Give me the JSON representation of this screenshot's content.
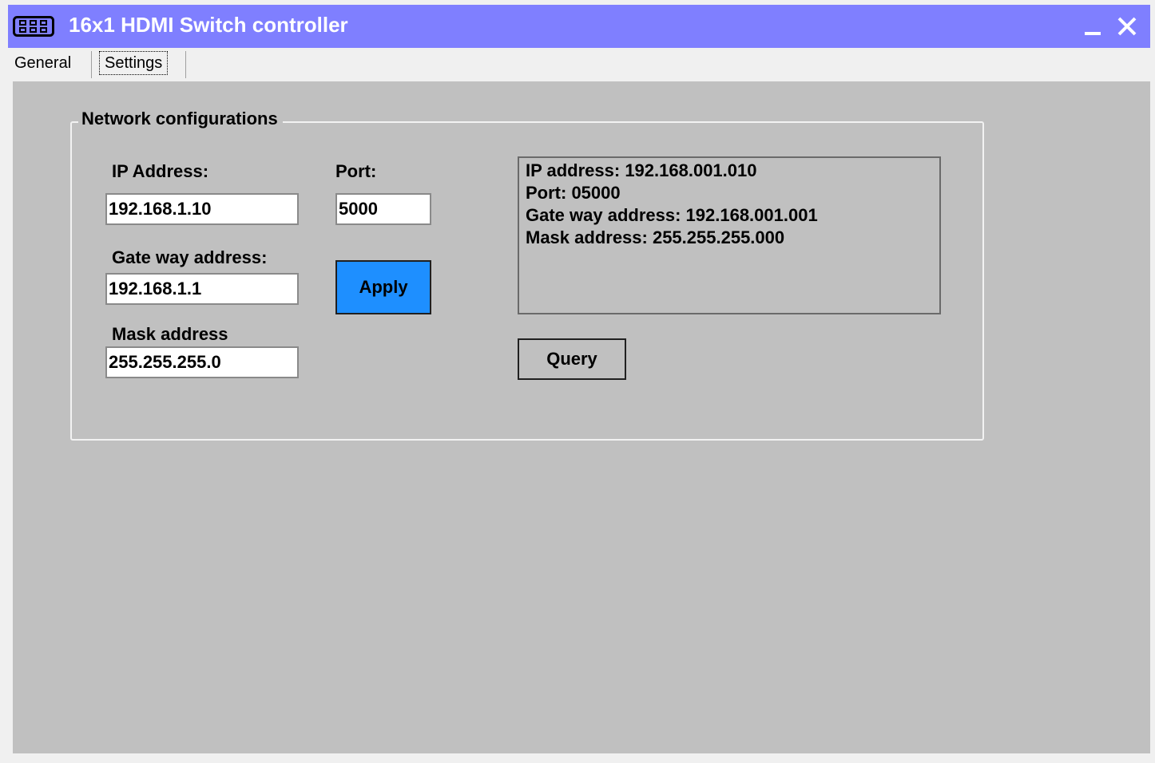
{
  "window": {
    "title": "16x1 HDMI Switch controller",
    "accent_color": "#7f7fff",
    "minimize_icon": "minimize-icon",
    "close_icon": "close-icon"
  },
  "tabs": [
    {
      "label": "General",
      "selected": false
    },
    {
      "label": "Settings",
      "selected": true
    }
  ],
  "network": {
    "group_title": "Network configurations",
    "ip_label": "IP Address:",
    "ip_value": "192.168.1.10",
    "port_label": "Port:",
    "port_value": "5000",
    "gateway_label": "Gate way address:",
    "gateway_value": "192.168.1.1",
    "mask_label": "Mask address",
    "mask_value": "255.255.255.0",
    "apply_label": "Apply",
    "apply_color": "#1e8fff",
    "query_label": "Query",
    "readout": [
      "IP address: 192.168.001.010",
      "Port: 05000",
      "Gate way address: 192.168.001.001",
      "Mask address: 255.255.255.000"
    ]
  }
}
